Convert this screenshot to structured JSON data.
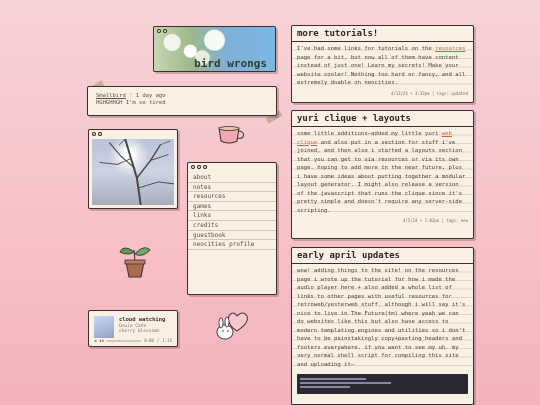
{
  "banner": {
    "title": "bird wrongs"
  },
  "status": {
    "user": "Smallbird",
    "heart": "♡",
    "time": "1 day ago",
    "message": "HGHGHHGH I'm so tired"
  },
  "nav": {
    "items": [
      "about",
      "notes",
      "resources",
      "games",
      "links",
      "credits",
      "guestbook",
      "neocities profile"
    ]
  },
  "player": {
    "title": "cloud watching",
    "artist": "Oswin Cafe",
    "album": "cherry blossoms",
    "elapsed": "0:00",
    "duration": "1:35",
    "progress": 0.0
  },
  "posts": [
    {
      "title": "more tutorials!",
      "body_pre": "I've had some links for tutorials on the ",
      "body_link": "resources",
      "body_post": " page for a bit, but now all of them have content instead of just one! Learn my secrets! Make your website cooler! Nothing too hard or fancy, and all extremely doable on neocities.",
      "meta": "4/13/24 • 3:33pm | tags: updated"
    },
    {
      "title": "yuri clique + layouts",
      "body_pre": "some little additions—added my little yuri ",
      "body_link": "web clique",
      "body_post": " and also put in a section for stuff i've joined, and then also i started a layouts section that you can get to via resources or via its own page. hoping to add more in the near future, plus i have some ideas about putting together a modular layout generator. I might also release a version of the javascript that runs the clique since it's pretty simple and doesn't require any server-side scripting.",
      "meta": "4/5/24 • 1:02pm | tags: new"
    },
    {
      "title": "early april updates",
      "body_pre": "wow! adding things to the site! on the resources page i wrote up the tutorial for how i made the audio player here + also added a whole list of links to other pages with useful resources for retroweb/yesterweb stuff. although i will say it's nice to live in The Future(tm) where yeah we can do websites like this but also have access to modern templating engines and utilities so i don't have to be painstakingly copy+pasting headers and footers everywhere.",
      "body_link": "",
      "body_post": " if you want to see my uh. my very normal shell script for compiling this site and uploading it—",
      "meta": ""
    }
  ],
  "colors": {
    "background": "#f7d3d6",
    "window": "#fbf0e4",
    "ink": "#3a2e2e",
    "link": "#b96a4a"
  }
}
